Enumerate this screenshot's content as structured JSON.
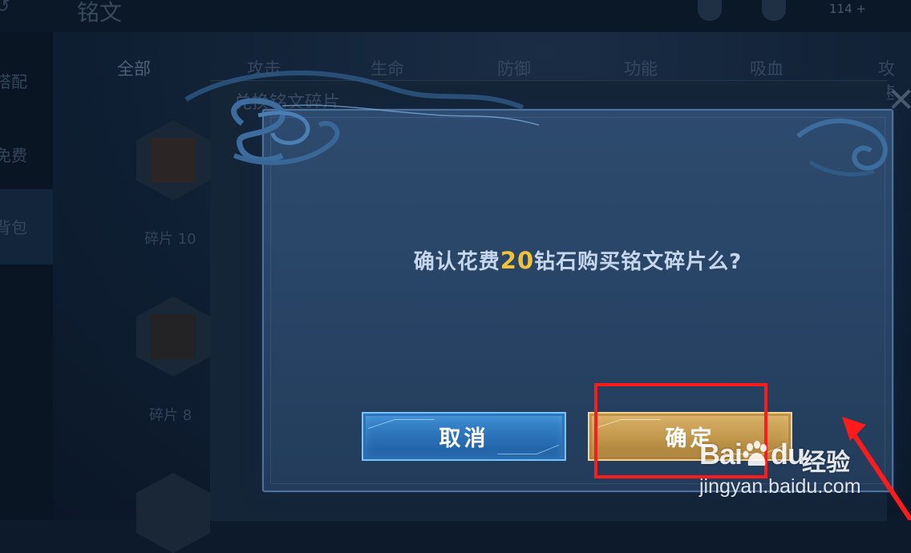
{
  "background": {
    "screen_title": "铭文",
    "coin_count": "114",
    "tabs": [
      "全部",
      "攻击",
      "生命",
      "防御",
      "功能",
      "吸血",
      "攻速"
    ],
    "sidebar": [
      "搭配",
      "免费",
      "背包"
    ],
    "panel_title": "兑换铭文碎片",
    "item_labels": [
      "碎片 10",
      "碎片 8"
    ]
  },
  "dialog": {
    "message_before": "确认花费",
    "amount": "20",
    "message_after": "钻石购买铭文碎片么?",
    "cancel_label": "取消",
    "confirm_label": "确定"
  },
  "watermark": {
    "logo_text_a": "Bai",
    "logo_text_b": "du",
    "product": "经验",
    "url": "jingyan.baidu.com"
  },
  "colors": {
    "dialog_bg": "#294567",
    "amount": "#f0c23a",
    "cancel_button": "#2a6fb6",
    "confirm_button": "#c49a4f",
    "annotation": "#ff1b1b"
  }
}
